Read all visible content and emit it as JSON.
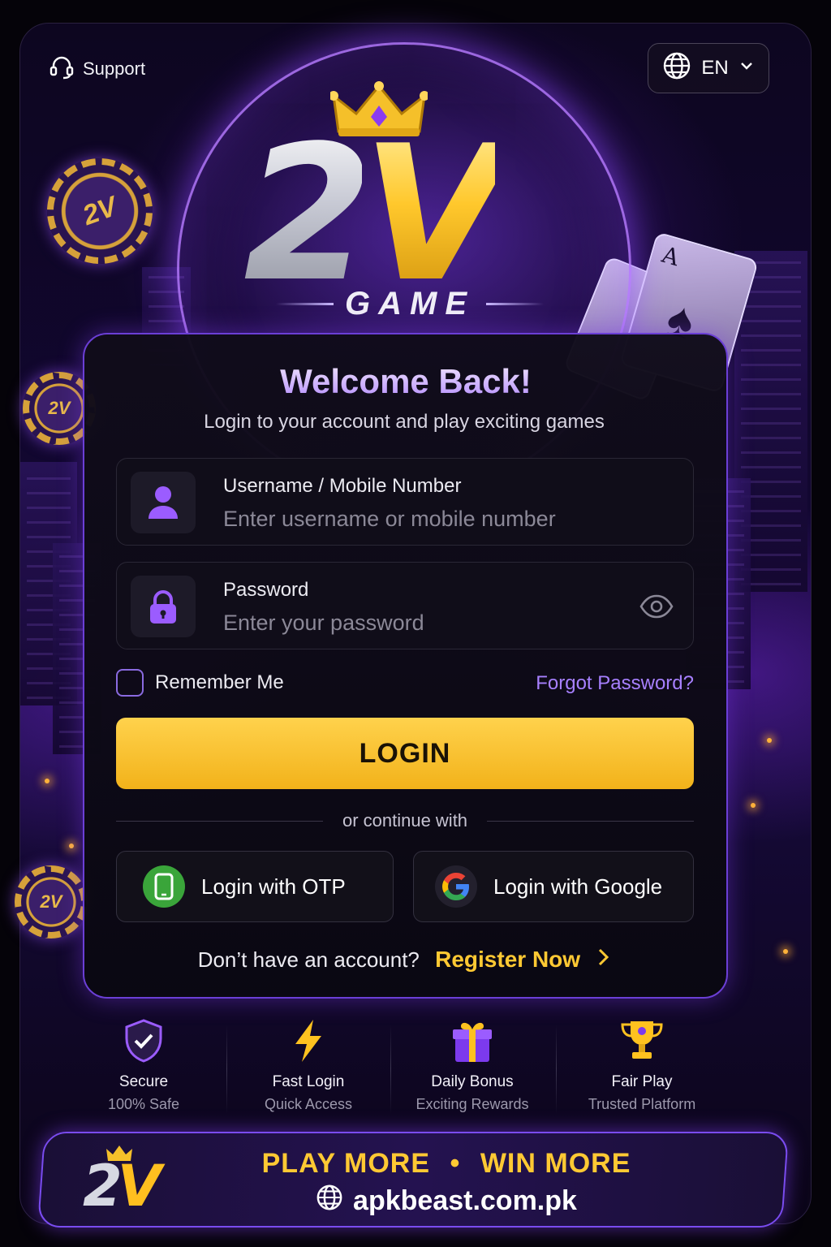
{
  "header": {
    "support_label": "Support",
    "language": "EN"
  },
  "logo": {
    "part1": "2",
    "part2": "V",
    "subtitle": "GAME",
    "chip_text": "2V"
  },
  "login": {
    "title": "Welcome Back!",
    "subtitle": "Login to your account and play exciting games",
    "username": {
      "label": "Username / Mobile Number",
      "placeholder": "Enter username or mobile number"
    },
    "password": {
      "label": "Password",
      "placeholder": "Enter your password"
    },
    "remember_label": "Remember Me",
    "forgot_label": "Forgot Password?",
    "login_button": "LOGIN",
    "divider_text": "or continue with",
    "otp_button": "Login with OTP",
    "google_button": "Login with Google",
    "no_account_text": "Don’t have an account?",
    "register_link": "Register Now"
  },
  "features": [
    {
      "icon": "shield-check-icon",
      "title": "Secure",
      "subtitle": "100% Safe"
    },
    {
      "icon": "lightning-icon",
      "title": "Fast Login",
      "subtitle": "Quick Access"
    },
    {
      "icon": "gift-icon",
      "title": "Daily Bonus",
      "subtitle": "Exciting Rewards"
    },
    {
      "icon": "trophy-icon",
      "title": "Fair Play",
      "subtitle": "Trusted Platform"
    }
  ],
  "banner": {
    "slogan_left": "PLAY MORE",
    "slogan_sep": "•",
    "slogan_right": "WIN MORE",
    "website": "apkbeast.com.pk"
  },
  "colors": {
    "accent_purple": "#7c3aed",
    "link_purple": "#a780ff",
    "gold": "#ffc933",
    "login_button": "#f2b21a"
  }
}
